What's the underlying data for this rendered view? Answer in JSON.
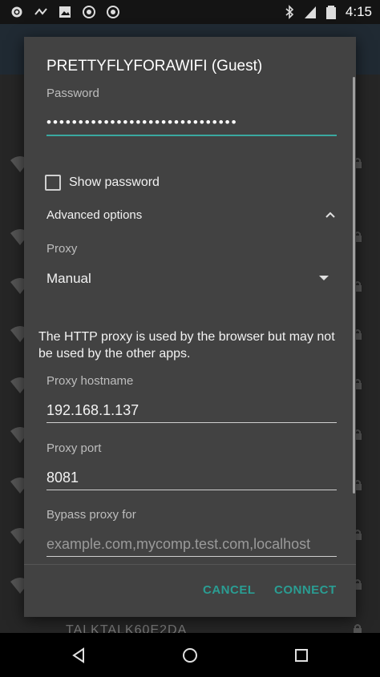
{
  "status_bar": {
    "time": "4:15",
    "left_icons": [
      "settings-icon",
      "wave-icon",
      "image-icon",
      "record-icon",
      "record-icon"
    ],
    "right_icons": [
      "bluetooth-icon",
      "signal-icon",
      "battery-icon"
    ]
  },
  "background": {
    "bottom_text": "TALKTALK60E2DA"
  },
  "dialog": {
    "title": "PRETTYFLYFORAWIFI (Guest)",
    "password_label": "Password",
    "password_value": "••••••••••••••••••••••••••••••",
    "show_password_label": "Show password",
    "advanced_label": "Advanced options",
    "proxy_label": "Proxy",
    "proxy_value": "Manual",
    "info_text": "The HTTP proxy is used by the browser but may not be used by the other apps.",
    "hostname_label": "Proxy hostname",
    "hostname_value": "192.168.1.137",
    "port_label": "Proxy port",
    "port_value": "8081",
    "bypass_label": "Bypass proxy for",
    "bypass_placeholder": "example.com,mycomp.test.com,localhost",
    "cancel_label": "CANCEL",
    "connect_label": "CONNECT",
    "accent_color": "#2a9d93"
  },
  "nav": {
    "icons": [
      "back-icon",
      "home-icon",
      "recents-icon"
    ]
  }
}
